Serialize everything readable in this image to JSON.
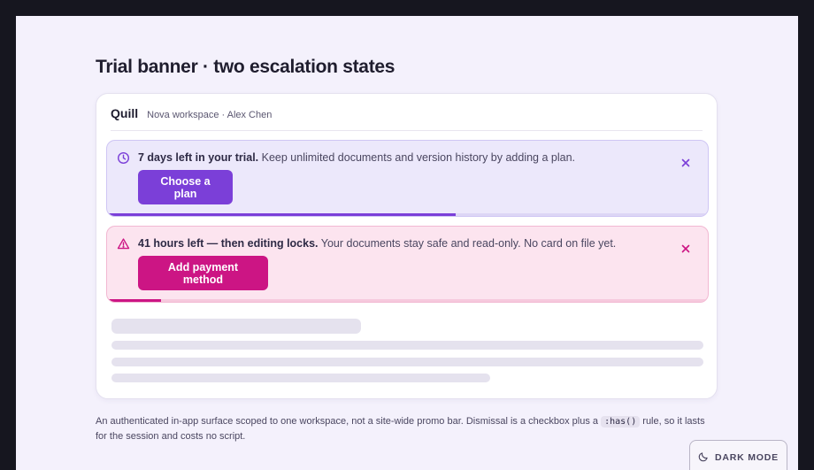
{
  "page": {
    "heading": "Trial banner · two escalation states"
  },
  "card": {
    "brand": "Quill",
    "context": "Nova workspace · Alex Chen"
  },
  "banners": [
    {
      "kind": "trial",
      "icon": "clock-icon",
      "strong": "7 days left in your trial.",
      "text": " Keep unlimited documents and version history by adding a plan.",
      "button": "Choose a plan",
      "progress": 0.58,
      "accent": "#7b3fd8"
    },
    {
      "kind": "urgent",
      "icon": "warning-icon",
      "strong": "41 hours left — then editing locks.",
      "text": " Your documents stay safe and read-only. No card on file yet.",
      "button": "Add payment method",
      "progress": 0.09,
      "accent": "#cc1584"
    }
  ],
  "footnote": {
    "before": "An authenticated in-app surface scoped to one workspace, not a site-wide promo bar. Dismissal is a checkbox plus a ",
    "code": ":has()",
    "after": " rule, so it lasts for the session and costs no script."
  },
  "toggle": {
    "label": "DARK MODE",
    "icon": "moon-icon"
  }
}
